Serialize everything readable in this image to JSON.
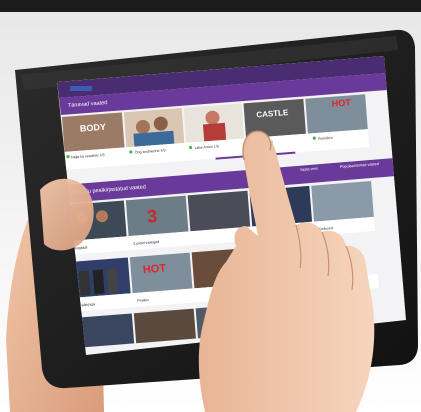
{
  "screen": {
    "brand_badge": "",
    "section1_title": "Tänavad vaated",
    "section1_items": [
      {
        "poster_text": "BODY",
        "caption": "Nalja ka seadese 1/3"
      },
      {
        "poster_text": "",
        "caption": "Õng andmeohe 4/3"
      },
      {
        "poster_text": "",
        "caption": "Lähe Ameri 1/3"
      },
      {
        "poster_text": "CASTLE",
        "caption": "Castle 1/3"
      },
      {
        "poster_text": "HOT",
        "caption": "Resident"
      }
    ],
    "section2_title": "For elu pealkirjastatud vaated",
    "section2_tabs": [
      "Vaata veel",
      "Populaarsemad vaated"
    ],
    "section2_row1": [
      {
        "caption": "Ringkaal"
      },
      {
        "caption": "3 pildid vaatajad"
      },
      {
        "caption": ""
      },
      {
        "caption": "Kodused"
      }
    ],
    "section2_row2": [
      {
        "poster_text": "",
        "caption": "Pealkirjaga"
      },
      {
        "poster_text": "HOT",
        "caption": "Pealiku"
      },
      {
        "poster_text": "",
        "caption": ""
      }
    ],
    "accent_color": "#6a3a9a",
    "icons": [
      "play-icon"
    ]
  }
}
